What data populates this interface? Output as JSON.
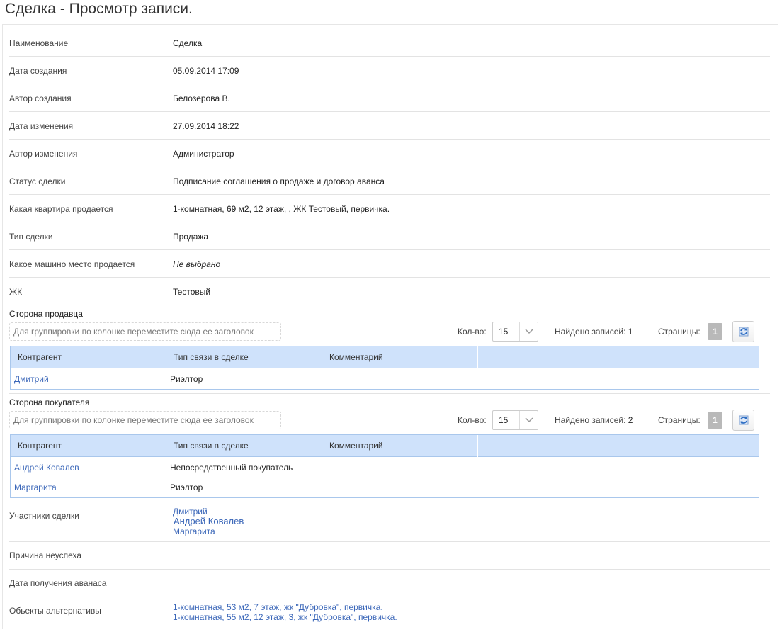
{
  "page": {
    "title": "Сделка  - Просмотр записи."
  },
  "fields": {
    "name": {
      "label": "Наименование",
      "value": "Сделка"
    },
    "created_date": {
      "label": "Дата создания",
      "value": "05.09.2014 17:09"
    },
    "created_by": {
      "label": "Автор создания",
      "value": "Белозерова В."
    },
    "modified_date": {
      "label": "Дата изменения",
      "value": "27.09.2014 18:22"
    },
    "modified_by": {
      "label": "Автор изменения",
      "value": "Администратор"
    },
    "status": {
      "label": "Статус сделки",
      "value": "Подписание соглашения о продаже и договор аванса"
    },
    "apartment": {
      "label": "Какая квартира продается",
      "value": "1-комнатная, 69 м2, 12 этаж, , ЖК Тестовый, первичка."
    },
    "deal_type": {
      "label": "Тип сделки",
      "value": "Продажа"
    },
    "parking": {
      "label": "Какое машино место продается",
      "value": "Не выбрано"
    },
    "complex": {
      "label": "ЖК",
      "value": "Тестовый"
    }
  },
  "seller": {
    "title": "Сторона продавца",
    "group_hint": "Для группировки по колонке переместите сюда ее заголовок",
    "count_label": "Кол-во:",
    "count_value": "15",
    "found_label": "Найдено записей:",
    "found_value": "1",
    "pages_label": "Страницы:",
    "page": "1",
    "columns": [
      "Контрагент",
      "Тип связи в сделке",
      "Комментарий"
    ],
    "rows": [
      {
        "party": "Дмитрий",
        "relation": "Риэлтор",
        "comment": ""
      }
    ]
  },
  "buyer": {
    "title": "Сторона покупателя",
    "group_hint": "Для группировки по колонке переместите сюда ее заголовок",
    "count_label": "Кол-во:",
    "count_value": "15",
    "found_label": "Найдено записей:",
    "found_value": "2",
    "pages_label": "Страницы:",
    "page": "1",
    "columns": [
      "Контрагент",
      "Тип связи в сделке",
      "Комментарий"
    ],
    "rows": [
      {
        "party": "Андрей Ковалев",
        "relation": "Непосредственный покупатель",
        "comment": ""
      },
      {
        "party": "Маргарита",
        "relation": "Риэлтор",
        "comment": ""
      }
    ]
  },
  "participants": {
    "label": "Участники сделки",
    "values": [
      "Дмитрий",
      "Андрей Ковалев",
      "Маргарита"
    ]
  },
  "failure_reason": {
    "label": "Причина неуспеха",
    "value": ""
  },
  "advance_date": {
    "label": "Дата получения аванаса",
    "value": ""
  },
  "alternatives": {
    "label": "Обьекты альтернативы",
    "values": [
      "1-комнатная, 53 м2, 7 этаж, жк \"Дубровка\", первичка.",
      "1-комнатная, 55 м2, 12 этаж, 3, жк \"Дубровка\", первичка."
    ]
  },
  "icons": {
    "refresh": "refresh-icon",
    "dropdown": "chevron-down-icon"
  },
  "colors": {
    "link": "#3a66b8",
    "grid_header": "#cfe2fb",
    "grid_border": "#a9c7ec"
  }
}
